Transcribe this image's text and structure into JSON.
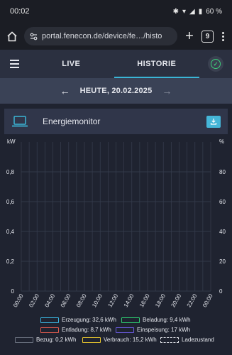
{
  "status_bar": {
    "time": "00:02",
    "battery": "60 %"
  },
  "browser": {
    "url": "portal.fenecon.de/device/fe…/histo",
    "tab_count": "9"
  },
  "header": {
    "tabs": [
      {
        "label": "LIVE"
      },
      {
        "label": "HISTORIE"
      }
    ]
  },
  "date_bar": {
    "date": "HEUTE, 20.02.2025"
  },
  "card": {
    "title": "Energiemonitor"
  },
  "colors": {
    "accent": "#3ab5d6",
    "ok": "#3ccf7a"
  },
  "chart_data": {
    "type": "line",
    "y_left_unit": "kW",
    "y_right_unit": "%",
    "y_left_ticks": [
      "0",
      "0,2",
      "0,4",
      "0,6",
      "0,8"
    ],
    "y_right_ticks": [
      "0",
      "20",
      "40",
      "60",
      "80"
    ],
    "ylim_left": [
      0,
      1
    ],
    "ylim_right": [
      0,
      100
    ],
    "x_ticks": [
      "00:00",
      "02:00",
      "04:00",
      "06:00",
      "08:00",
      "10:00",
      "12:00",
      "14:00",
      "16:00",
      "18:00",
      "20:00",
      "22:00",
      "00:00"
    ],
    "grid": true,
    "series": []
  },
  "legend": [
    {
      "label": "Erzeugung: 32,6 kWh",
      "color": "#3ab5e0"
    },
    {
      "label": "Beladung: 9,4 kWh",
      "color": "#2ecc71"
    },
    {
      "label": "Entladung: 8,7 kWh",
      "color": "#e05a4e"
    },
    {
      "label": "Einspeisung: 17 kWh",
      "color": "#6a5be0"
    },
    {
      "label": "Bezug: 0,2 kWh",
      "color": "#6b7280"
    },
    {
      "label": "Verbrauch: 15,2 kWh",
      "color": "#e8c62e"
    },
    {
      "label": "Ladezustand",
      "color": "#e6e8ee"
    }
  ]
}
